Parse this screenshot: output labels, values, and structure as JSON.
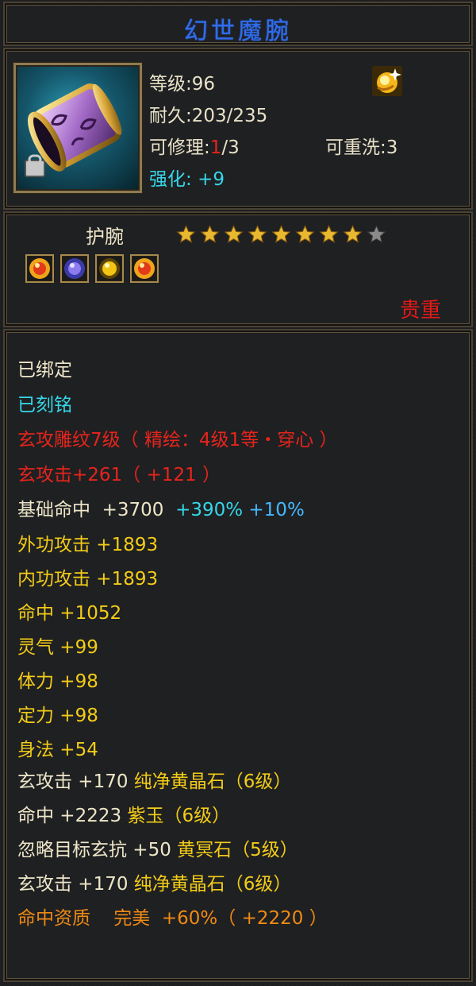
{
  "item": {
    "name": "幻世魔腕",
    "level_label": "等级:",
    "level": "96",
    "durability_label": "耐久:",
    "durability": "203/235",
    "repair_label": "可修理:",
    "repair_used": "1",
    "repair_total": "/3",
    "reroll_label": "可重洗:",
    "reroll": "3",
    "enhance_label": "强化:",
    "enhance": "+9",
    "type": "护腕",
    "stars_filled": 8,
    "stars_total": 9,
    "quality": "贵重",
    "icon": "wrist-guard-icon",
    "badge_icon": "gold-sparkle-icon",
    "gem_icons": [
      "fire-gem-icon",
      "purple-gem-icon",
      "yellow-gem-icon",
      "fire-gem-icon"
    ]
  },
  "attributes": {
    "bound": "已绑定",
    "engraved": "已刻铭",
    "carving": "玄攻雕纹7级（ 精绘：4级1等・穿心 ）",
    "xuan_attack": "玄攻击+261（ +121 ）",
    "hit_base_label": "基础命中",
    "hit_base_value": "+3700",
    "hit_base_bonus1": "+390%",
    "hit_base_bonus2": "+10%",
    "lines": [
      "外功攻击  +1893",
      "内功攻击  +1893",
      "命中  +1052",
      "灵气  +99",
      "体力  +98",
      "定力  +98",
      "身法  +54"
    ],
    "gem_lines": [
      {
        "stat": "玄攻击  +170",
        "gem": "纯净黄晶石（6级）"
      },
      {
        "stat": "命中  +2223",
        "gem": "紫玉（6级）"
      },
      {
        "stat": "忽略目标玄抗  +50",
        "gem": "黄冥石（5级）"
      },
      {
        "stat": "玄攻击  +170",
        "gem": "纯净黄晶石（6级）"
      }
    ],
    "aptitude_label": "命中资质",
    "aptitude_grade": "完美",
    "aptitude_value": "+60%（ +2220 ）"
  },
  "colors": {
    "title": "#2e6df0",
    "cyan": "#36d6e8",
    "red": "#e6241c",
    "yellow": "#f2cc18",
    "orange": "#ef8a14",
    "white": "#eee6c8"
  }
}
